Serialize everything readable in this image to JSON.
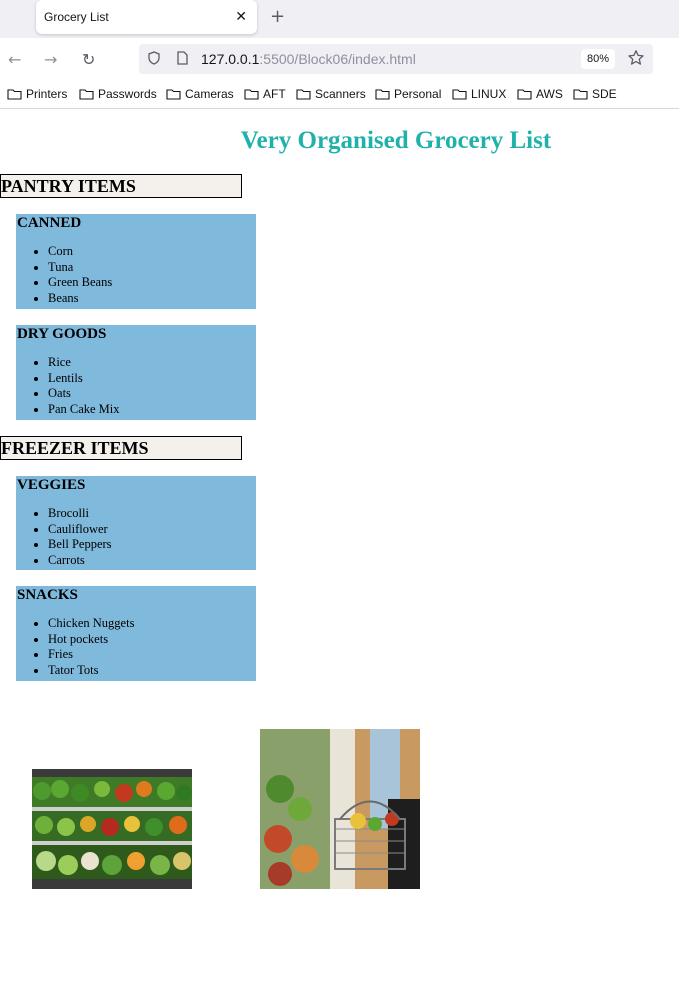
{
  "browser": {
    "tab": {
      "title": "Grocery List",
      "close": "✕"
    },
    "new_tab": "+",
    "nav": {
      "back": "←",
      "forward": "→",
      "reload": "↻"
    },
    "url": {
      "host": "127.0.0.1",
      "path": ":5500/Block06/index.html"
    },
    "zoom": "80%",
    "bookmarks": [
      "Printers",
      "Passwords",
      "Cameras",
      "AFT",
      "Scanners",
      "Personal",
      "LINUX",
      "AWS",
      "SDE"
    ]
  },
  "page": {
    "title": "Very Organised Grocery List",
    "sections": [
      {
        "heading": "PANTRY ITEMS",
        "groups": [
          {
            "title": "CANNED",
            "items": [
              "Corn",
              "Tuna",
              "Green Beans",
              "Beans"
            ]
          },
          {
            "title": "DRY GOODS",
            "items": [
              "Rice",
              "Lentils",
              "Oats",
              "Pan Cake Mix"
            ]
          }
        ]
      },
      {
        "heading": "FREEZER ITEMS",
        "groups": [
          {
            "title": "VEGGIES",
            "items": [
              "Brocolli",
              "Cauliflower",
              "Bell Peppers",
              "Carrots"
            ]
          },
          {
            "title": "SNACKS",
            "items": [
              "Chicken Nuggets",
              "Hot pockets",
              "Fries",
              "Tator Tots"
            ]
          }
        ]
      }
    ],
    "images": [
      "produce-shelves-photo",
      "shopping-basket-photo"
    ]
  },
  "colors": {
    "title": "#20b2aa",
    "box": "#7fb9dc",
    "section_bg": "#f4f1ec"
  }
}
